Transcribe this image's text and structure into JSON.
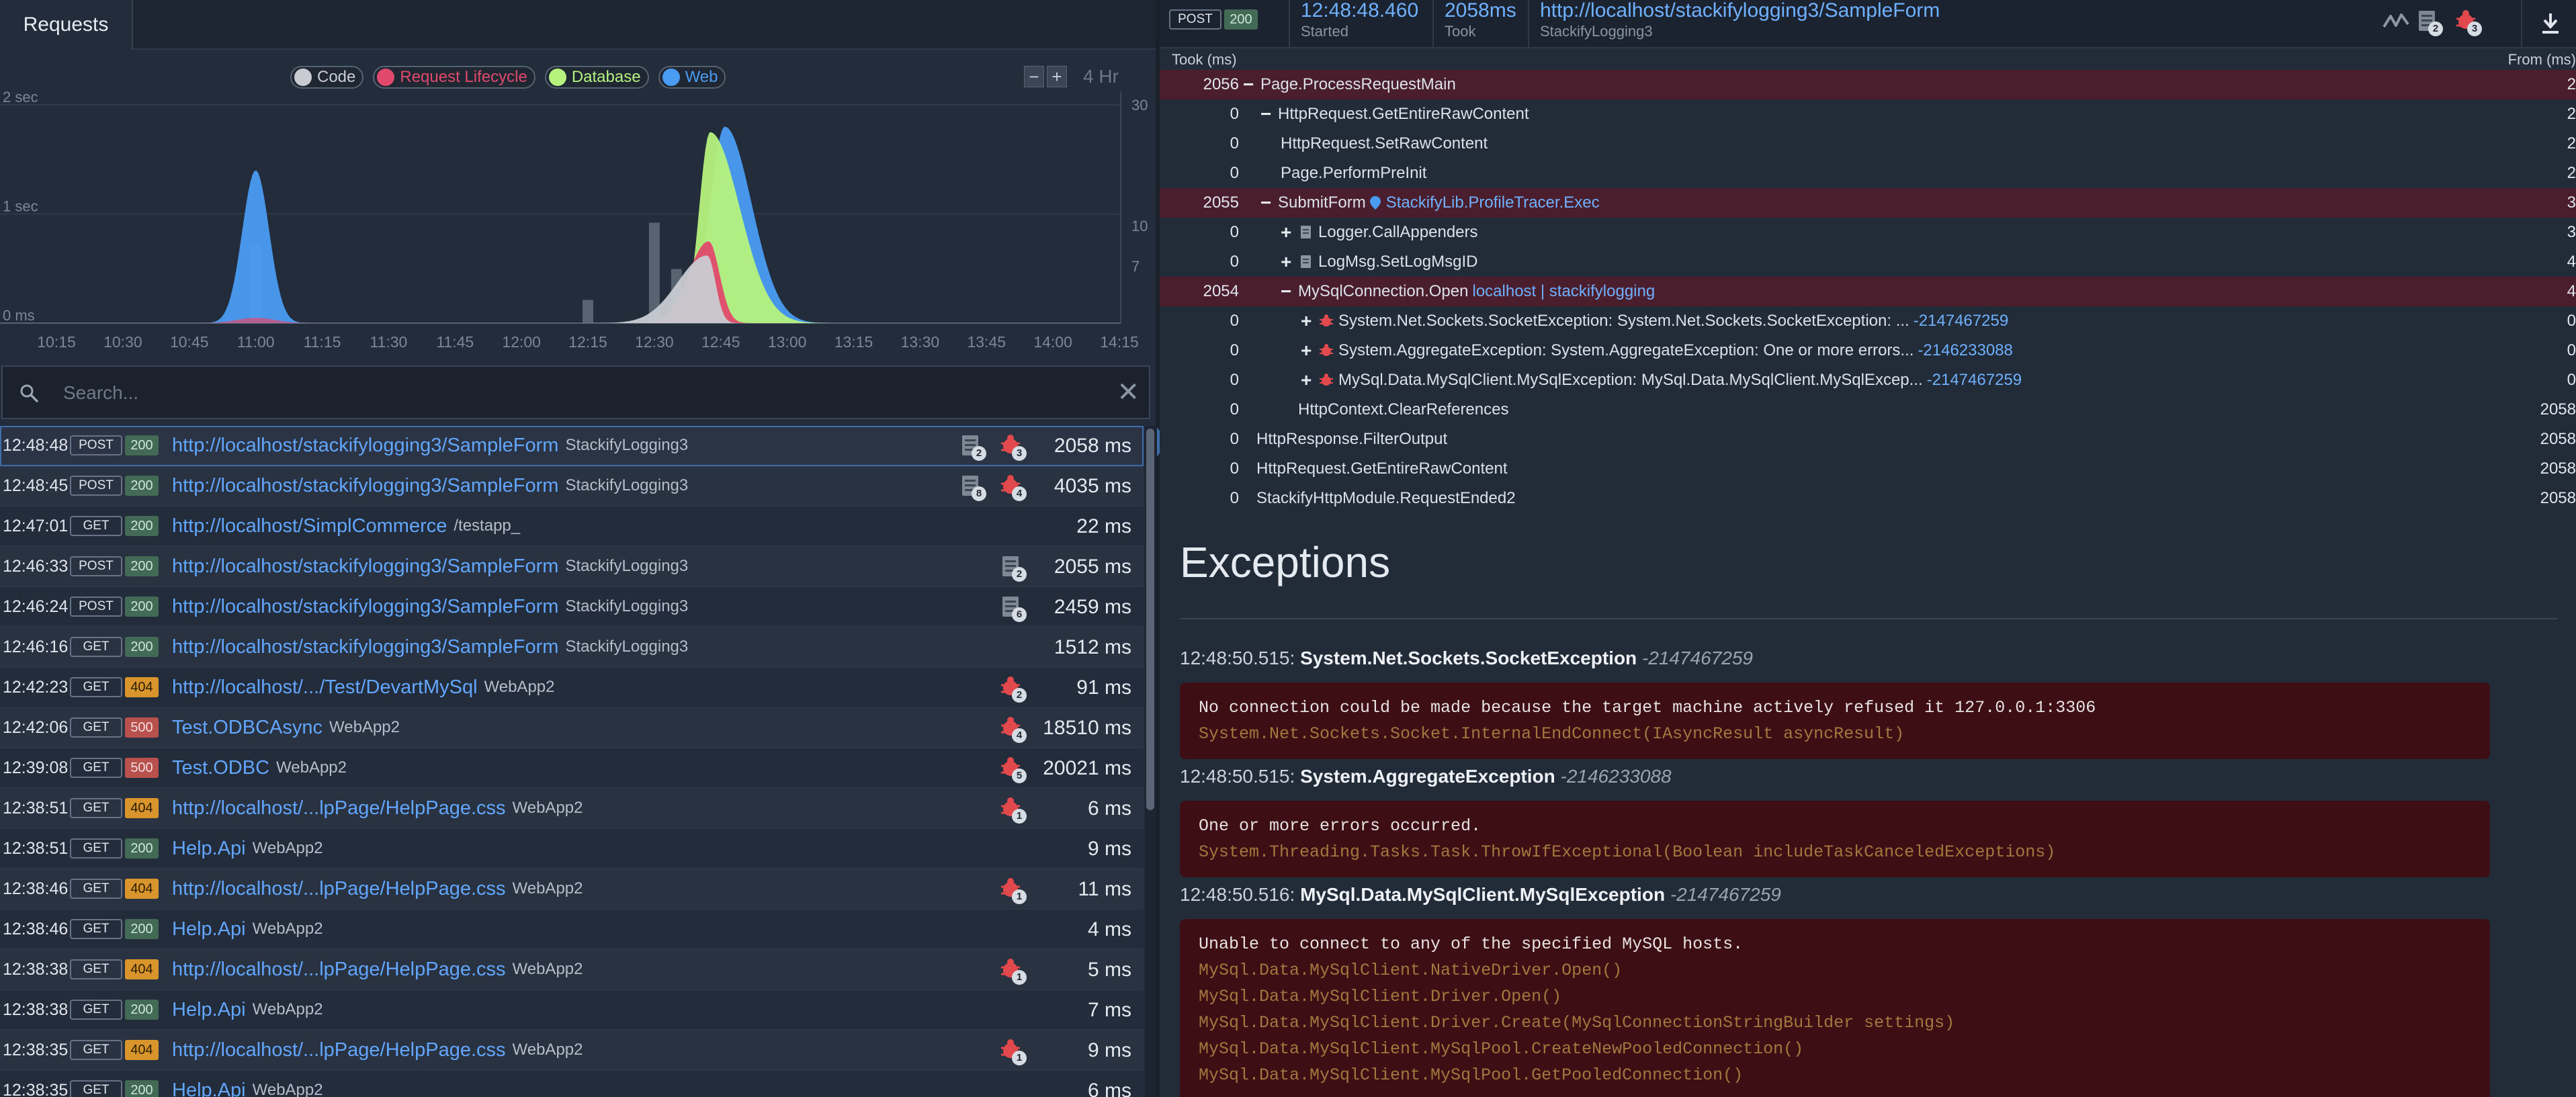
{
  "tabs": {
    "requests": "Requests"
  },
  "chart": {
    "legend": [
      {
        "label": "Code",
        "color": "#c8ccd2"
      },
      {
        "label": "Request Lifecycle",
        "color": "#e0496c"
      },
      {
        "label": "Database",
        "color": "#b6f27e"
      },
      {
        "label": "Web",
        "color": "#4a9cf2"
      }
    ],
    "zoom_minus": "−",
    "zoom_plus": "+",
    "range": "4 Hr",
    "y_left": [
      "2 sec",
      "1 sec",
      "0 ms"
    ],
    "y_right": [
      "30",
      "10",
      "7"
    ],
    "x_ticks": [
      "10:15",
      "10:30",
      "10:45",
      "11:00",
      "11:15",
      "11:30",
      "11:45",
      "12:00",
      "12:15",
      "12:30",
      "12:45",
      "13:00",
      "13:15",
      "13:30",
      "13:45",
      "14:00",
      "14:15"
    ]
  },
  "chart_data": {
    "type": "area",
    "title": "",
    "x": [
      "10:15",
      "10:30",
      "10:45",
      "11:00",
      "11:15",
      "11:30",
      "11:45",
      "12:00",
      "12:15",
      "12:30",
      "12:45",
      "13:00",
      "13:15",
      "13:30",
      "13:45",
      "14:00",
      "14:15"
    ],
    "xlabel": "",
    "ylabel": "",
    "ylim": [
      0,
      2
    ],
    "y_unit": "sec",
    "y2_ticks": [
      30,
      10,
      7
    ],
    "grid": true,
    "legend_placement": "top-center",
    "series": [
      {
        "name": "Web",
        "values": [
          0,
          0,
          0.2,
          1.4,
          0.1,
          0,
          0,
          0,
          0,
          0.3,
          1.8,
          0.4,
          0,
          0,
          0,
          0,
          0
        ]
      },
      {
        "name": "Database",
        "values": [
          0,
          0,
          0,
          0,
          0,
          0,
          0,
          0,
          0,
          0.2,
          1.75,
          0.1,
          0,
          0,
          0,
          0,
          0
        ]
      },
      {
        "name": "Request Lifecycle",
        "values": [
          0,
          0,
          0,
          0.1,
          0,
          0,
          0,
          0,
          0,
          0.1,
          0.75,
          0,
          0,
          0,
          0,
          0,
          0
        ]
      },
      {
        "name": "Code",
        "values": [
          0,
          0,
          0,
          0.1,
          0,
          0,
          0,
          0,
          0.1,
          0.5,
          0.7,
          0,
          0,
          0,
          0,
          0,
          0
        ]
      }
    ],
    "bars_count": [
      {
        "x": "11:00",
        "value": 10
      },
      {
        "x": "12:15",
        "value": 3
      },
      {
        "x": "12:30",
        "value": 13
      },
      {
        "x": "12:35",
        "value": 7
      }
    ]
  },
  "search": {
    "placeholder": "Search..."
  },
  "requests": [
    {
      "time": "12:48:48",
      "method": "POST",
      "status": "200",
      "url": "http://localhost/stackifylogging3/SampleForm",
      "app": "StackifyLogging3",
      "logs": "2",
      "errors": "3",
      "ms": "2058 ms"
    },
    {
      "time": "12:48:45",
      "method": "POST",
      "status": "200",
      "url": "http://localhost/stackifylogging3/SampleForm",
      "app": "StackifyLogging3",
      "logs": "8",
      "errors": "4",
      "ms": "4035 ms"
    },
    {
      "time": "12:47:01",
      "method": "GET",
      "status": "200",
      "url": "http://localhost/SimplCommerce",
      "app": "/testapp_",
      "logs": "",
      "errors": "",
      "ms": "22 ms"
    },
    {
      "time": "12:46:33",
      "method": "POST",
      "status": "200",
      "url": "http://localhost/stackifylogging3/SampleForm",
      "app": "StackifyLogging3",
      "logs": "2",
      "errors": "",
      "ms": "2055 ms"
    },
    {
      "time": "12:46:24",
      "method": "POST",
      "status": "200",
      "url": "http://localhost/stackifylogging3/SampleForm",
      "app": "StackifyLogging3",
      "logs": "6",
      "errors": "",
      "ms": "2459 ms"
    },
    {
      "time": "12:46:16",
      "method": "GET",
      "status": "200",
      "url": "http://localhost/stackifylogging3/SampleForm",
      "app": "StackifyLogging3",
      "logs": "",
      "errors": "",
      "ms": "1512 ms"
    },
    {
      "time": "12:42:23",
      "method": "GET",
      "status": "404",
      "url": "http://localhost/.../Test/DevartMySql",
      "app": "WebApp2",
      "logs": "",
      "errors": "2",
      "ms": "91 ms"
    },
    {
      "time": "12:42:06",
      "method": "GET",
      "status": "500",
      "url": "Test.ODBCAsync",
      "app": "WebApp2",
      "logs": "",
      "errors": "4",
      "ms": "18510 ms"
    },
    {
      "time": "12:39:08",
      "method": "GET",
      "status": "500",
      "url": "Test.ODBC",
      "app": "WebApp2",
      "logs": "",
      "errors": "5",
      "ms": "20021 ms"
    },
    {
      "time": "12:38:51",
      "method": "GET",
      "status": "404",
      "url": "http://localhost/...lpPage/HelpPage.css",
      "app": "WebApp2",
      "logs": "",
      "errors": "1",
      "ms": "6 ms"
    },
    {
      "time": "12:38:51",
      "method": "GET",
      "status": "200",
      "url": "Help.Api",
      "app": "WebApp2",
      "logs": "",
      "errors": "",
      "ms": "9 ms"
    },
    {
      "time": "12:38:46",
      "method": "GET",
      "status": "404",
      "url": "http://localhost/...lpPage/HelpPage.css",
      "app": "WebApp2",
      "logs": "",
      "errors": "1",
      "ms": "11 ms"
    },
    {
      "time": "12:38:46",
      "method": "GET",
      "status": "200",
      "url": "Help.Api",
      "app": "WebApp2",
      "logs": "",
      "errors": "",
      "ms": "4 ms"
    },
    {
      "time": "12:38:38",
      "method": "GET",
      "status": "404",
      "url": "http://localhost/...lpPage/HelpPage.css",
      "app": "WebApp2",
      "logs": "",
      "errors": "1",
      "ms": "5 ms"
    },
    {
      "time": "12:38:38",
      "method": "GET",
      "status": "200",
      "url": "Help.Api",
      "app": "WebApp2",
      "logs": "",
      "errors": "",
      "ms": "7 ms"
    },
    {
      "time": "12:38:35",
      "method": "GET",
      "status": "404",
      "url": "http://localhost/...lpPage/HelpPage.css",
      "app": "WebApp2",
      "logs": "",
      "errors": "1",
      "ms": "9 ms"
    },
    {
      "time": "12:38:35",
      "method": "GET",
      "status": "200",
      "url": "Help.Api",
      "app": "WebApp2",
      "logs": "",
      "errors": "",
      "ms": "6 ms"
    }
  ],
  "detail": {
    "method": "POST",
    "status": "200",
    "started": "12:48:48.460",
    "started_label": "Started",
    "took": "2058ms",
    "took_label": "Took",
    "url": "http://localhost/stackifylogging3/SampleForm",
    "app": "StackifyLogging3",
    "logs_count": "2",
    "errors_count": "3",
    "took_header": "Took (ms)",
    "from_header": "From (ms)",
    "trace": [
      {
        "took": "2056",
        "toggle": "−",
        "name": "Page.ProcessRequestMain",
        "extra": "",
        "from": "2",
        "hot": true
      },
      {
        "took": "0",
        "toggle": "−",
        "name": "HttpRequest.GetEntireRawContent",
        "extra": "",
        "from": "2",
        "hot": false
      },
      {
        "took": "0",
        "toggle": "",
        "name": "HttpRequest.SetRawContent",
        "extra": "",
        "from": "2",
        "hot": false
      },
      {
        "took": "0",
        "toggle": "",
        "name": "Page.PerformPreInit",
        "extra": "",
        "from": "2",
        "hot": false
      },
      {
        "took": "2055",
        "toggle": "−",
        "name": "SubmitForm",
        "extra": "StackifyLib.ProfileTracer.Exec",
        "from": "3",
        "hot": true
      },
      {
        "took": "0",
        "toggle": "+",
        "name": "Logger.CallAppenders",
        "extra": "",
        "from": "3",
        "hot": false
      },
      {
        "took": "0",
        "toggle": "+",
        "name": "LogMsg.SetLogMsgID",
        "extra": "",
        "from": "4",
        "hot": false
      },
      {
        "took": "2054",
        "toggle": "−",
        "name": "MySqlConnection.Open",
        "extra": "localhost | stackifylogging",
        "from": "4",
        "hot": true
      },
      {
        "took": "0",
        "toggle": "+",
        "name": "System.Net.Sockets.SocketException: System.Net.Sockets.SocketException: ...",
        "extra": "-2147467259",
        "from": "0",
        "hot": false
      },
      {
        "took": "0",
        "toggle": "+",
        "name": "System.AggregateException: System.AggregateException: One or more errors...",
        "extra": "-2146233088",
        "from": "0",
        "hot": false
      },
      {
        "took": "0",
        "toggle": "+",
        "name": "MySql.Data.MySqlClient.MySqlException: MySql.Data.MySqlClient.MySqlExcep...",
        "extra": "-2147467259",
        "from": "0",
        "hot": false
      },
      {
        "took": "0",
        "toggle": "",
        "name": "HttpContext.ClearReferences",
        "extra": "",
        "from": "2058",
        "hot": false
      },
      {
        "took": "0",
        "toggle": "",
        "name": "HttpResponse.FilterOutput",
        "extra": "",
        "from": "2058",
        "hot": false
      },
      {
        "took": "0",
        "toggle": "",
        "name": "HttpRequest.GetEntireRawContent",
        "extra": "",
        "from": "2058",
        "hot": false
      },
      {
        "took": "0",
        "toggle": "",
        "name": "StackifyHttpModule.RequestEnded2",
        "extra": "",
        "from": "2058",
        "hot": false
      }
    ],
    "exceptions_title": "Exceptions",
    "exceptions": [
      {
        "time": "12:48:50.515:",
        "type": "System.Net.Sockets.SocketException",
        "code": "-2147467259",
        "message": "No connection could be made because the target machine actively refused it 127.0.0.1:3306",
        "stack": [
          "System.Net.Sockets.Socket.InternalEndConnect(IAsyncResult asyncResult)"
        ]
      },
      {
        "time": "12:48:50.515:",
        "type": "System.AggregateException",
        "code": "-2146233088",
        "message": "One or more errors occurred.",
        "stack": [
          "System.Threading.Tasks.Task.ThrowIfExceptional(Boolean includeTaskCanceledExceptions)"
        ]
      },
      {
        "time": "12:48:50.516:",
        "type": "MySql.Data.MySqlClient.MySqlException",
        "code": "-2147467259",
        "message": "Unable to connect to any of the specified MySQL hosts.",
        "stack": [
          "MySql.Data.MySqlClient.NativeDriver.Open()",
          "MySql.Data.MySqlClient.Driver.Open()",
          "MySql.Data.MySqlClient.Driver.Create(MySqlConnectionStringBuilder settings)",
          "MySql.Data.MySqlClient.MySqlPool.CreateNewPooledConnection()",
          "MySql.Data.MySqlClient.MySqlPool.GetPooledConnection()"
        ]
      }
    ]
  }
}
